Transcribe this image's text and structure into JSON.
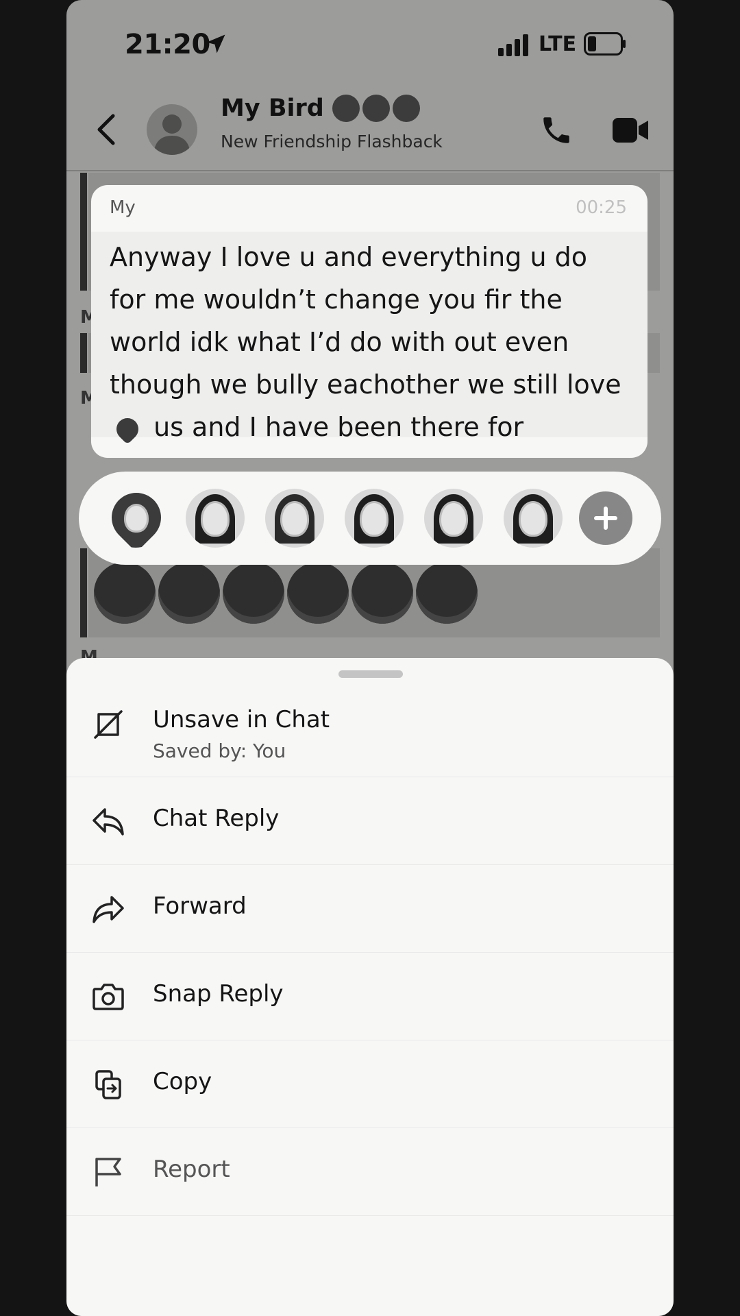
{
  "status_bar": {
    "time": "21:20",
    "network": "LTE"
  },
  "header": {
    "title": "My Bird",
    "subtitle": "New Friendship Flashback"
  },
  "background": {
    "letters": [
      "M",
      "M",
      "M"
    ]
  },
  "message": {
    "sender": "My",
    "time": "00:25",
    "text_before_emoji": "Anyway I love u and everything u do for me wouldn’t change you fir the world idk what I’d do with out even though we bully eachother we still love",
    "text_after_emoji": "us and I have been there for"
  },
  "reactions": {
    "items": [
      "heart-bitmoji-icon",
      "laugh-cry-bitmoji-icon",
      "fire-bitmoji-icon",
      "thumbs-up-bitmoji-icon",
      "thumbs-down-bitmoji-icon",
      "sad-bitmoji-icon"
    ],
    "add_icon": "plus-icon"
  },
  "menu": {
    "unsave": {
      "label": "Unsave in Chat",
      "sublabel": "Saved by: You",
      "icon": "unsave-icon"
    },
    "chat_reply": {
      "label": "Chat Reply",
      "icon": "reply-arrow-icon"
    },
    "forward": {
      "label": "Forward",
      "icon": "forward-arrow-icon"
    },
    "snap_reply": {
      "label": "Snap Reply",
      "icon": "camera-icon"
    },
    "copy": {
      "label": "Copy",
      "icon": "copy-icon"
    },
    "report": {
      "label": "Report",
      "icon": "flag-icon"
    }
  }
}
